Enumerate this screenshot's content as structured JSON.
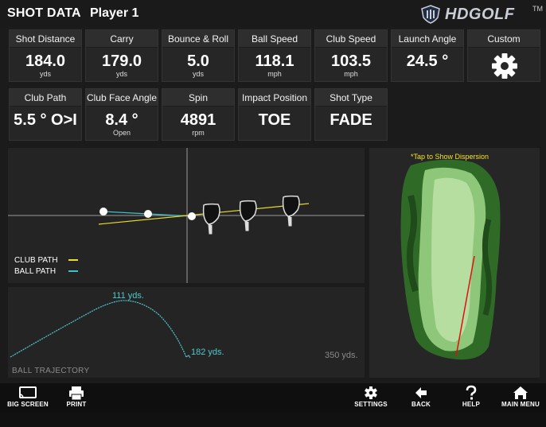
{
  "header": {
    "title": "SHOT DATA",
    "player": "Player 1",
    "brand": "HDGOLF",
    "trademark": "TM"
  },
  "stats_row1": [
    {
      "label": "Shot Distance",
      "value": "184.0",
      "unit": "yds"
    },
    {
      "label": "Carry",
      "value": "179.0",
      "unit": "yds"
    },
    {
      "label": "Bounce & Roll",
      "value": "5.0",
      "unit": "yds"
    },
    {
      "label": "Ball Speed",
      "value": "118.1",
      "unit": "mph"
    },
    {
      "label": "Club Speed",
      "value": "103.5",
      "unit": "mph"
    },
    {
      "label": "Launch Angle",
      "value": "24.5 °",
      "unit": ""
    },
    {
      "label": "Custom",
      "value": "",
      "unit": "",
      "icon": "gear-icon"
    }
  ],
  "stats_row2": [
    {
      "label": "Club Path",
      "value": "5.5 ° O>I",
      "unit": ""
    },
    {
      "label": "Club Face Angle",
      "value": "8.4 °",
      "unit": "Open"
    },
    {
      "label": "Spin",
      "value": "4891",
      "unit": "rpm"
    },
    {
      "label": "Impact Position",
      "value": "TOE",
      "unit": ""
    },
    {
      "label": "Shot Type",
      "value": "FADE",
      "unit": ""
    }
  ],
  "club_path_panel": {
    "legend": [
      {
        "label": "CLUB PATH",
        "color": "#e8de2c"
      },
      {
        "label": "BALL PATH",
        "color": "#3fc1c9"
      }
    ]
  },
  "trajectory_panel": {
    "title": "BALL TRAJECTORY",
    "apex_label": "111 yds.",
    "landing_label": "182 yds.",
    "scale_label": "350 yds.",
    "curve_color": "#4fc9cf"
  },
  "map_panel": {
    "hint": "*Tap to Show Dispersion",
    "shot_line_color": "#e01010"
  },
  "bottom_bar": {
    "big_screen": "BIG SCREEN",
    "print": "PRINT",
    "settings": "SETTINGS",
    "back": "BACK",
    "help": "HELP",
    "main_menu": "MAIN MENU"
  }
}
